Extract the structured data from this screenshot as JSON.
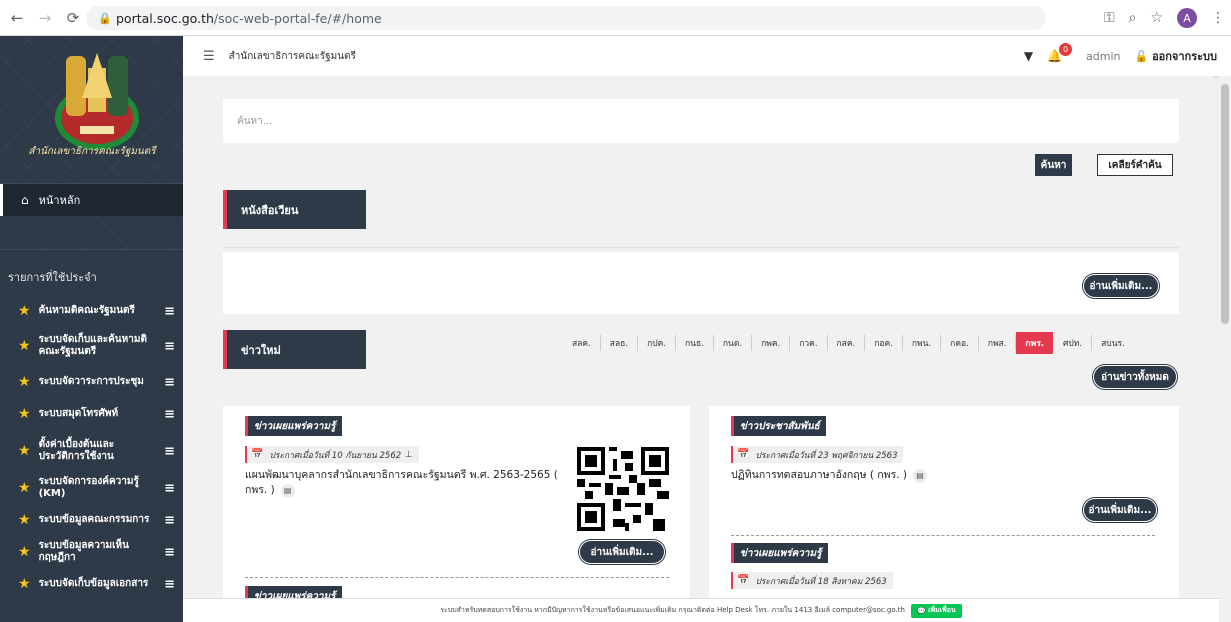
{
  "browser": {
    "url_host": "portal.soc.go.th",
    "url_path": "/soc-web-portal-fe/#/home",
    "avatar_letter": "A"
  },
  "sidebar": {
    "logo_caption": "สำนักเลขาธิการคณะรัฐมนตรี",
    "home_label": "หน้าหลัก",
    "section_title": "รายการที่ใช้ประจำ",
    "items": [
      {
        "label": "ค้นหามติคณะรัฐมนตรี"
      },
      {
        "label": "ระบบจัดเก็บและค้นหามติคณะรัฐมนตรี"
      },
      {
        "label": "ระบบจัดวาระการประชุม"
      },
      {
        "label": "ระบบสมุดโทรศัพท์"
      },
      {
        "label": "ตั้งค่าเบื้องต้นและประวัติการใช้งาน"
      },
      {
        "label": "ระบบจัดการองค์ความรู้ (KM)"
      },
      {
        "label": "ระบบข้อมูลคณะกรรมการ"
      },
      {
        "label": "ระบบข้อมูลความเห็นกฤษฎีกา"
      },
      {
        "label": "ระบบจัดเก็บข้อมูลเอกสาร"
      }
    ]
  },
  "header": {
    "org_name": "สำนักเลขาธิการคณะรัฐมนตรี",
    "notification_count": "0",
    "user": "admin",
    "logout_label": "ออกจากระบบ"
  },
  "search": {
    "placeholder": "ค้นหา...",
    "search_label": "ค้นหา",
    "clear_label": "เคลียร์คำค้น"
  },
  "circulars": {
    "title": "หนังสือเวียน",
    "more_label": "อ่านเพิ่มเติม..."
  },
  "news": {
    "title": "ข่าวใหม่",
    "tabs": [
      "สลค.",
      "สลธ.",
      "กปค.",
      "กนธ.",
      "กนต.",
      "กพค.",
      "กวค.",
      "กสค.",
      "กอค.",
      "กพน.",
      "กคอ.",
      "กพส.",
      "กพร.",
      "ศปท.",
      "สบนร."
    ],
    "active_tab": "กพร.",
    "all_label": "อ่านข่าวทั้งหมด",
    "left_card": {
      "tag": "ข่าวเผยแพร่ความรู้",
      "date": "ประกาศเมื่อวันที่ 10 กันยายน 2562",
      "title": "แผนพัฒนาบุคลากรสำนักเลขาธิการคณะรัฐมนตรี พ.ศ. 2563-2565 ( กพร. )",
      "more_label": "อ่านเพิ่มเติม...",
      "next_tag": "ข่าวเผยแพร่ความรู้"
    },
    "right_card": {
      "tag": "ข่าวประชาสัมพันธ์",
      "date": "ประกาศเมื่อวันที่ 23 พฤศจิกายน 2563",
      "title": "ปฏิทินการทดสอบภาษาอังกฤษ ( กพร. )",
      "more_label": "อ่านเพิ่มเติม...",
      "next_tag": "ข่าวเผยแพร่ความรู้",
      "next_date": "ประกาศเมื่อวันที่ 18 สิงหาคม 2563"
    }
  },
  "footer": {
    "text": "ระบบสำหรับทดสอบการใช้งาน หากมีปัญหาการใช้งานหรือข้อเสนอแนะเพิ่มเติม กรุณาติดต่อ Help Desk โทร. ภายใน 1413 อีเมล์ computer@soc.go.th",
    "line_label": "เพิ่มเพื่อน"
  },
  "colors": {
    "sidebar_bg": "#2f3a49",
    "accent_red": "#e53950",
    "star": "#f5c518"
  }
}
